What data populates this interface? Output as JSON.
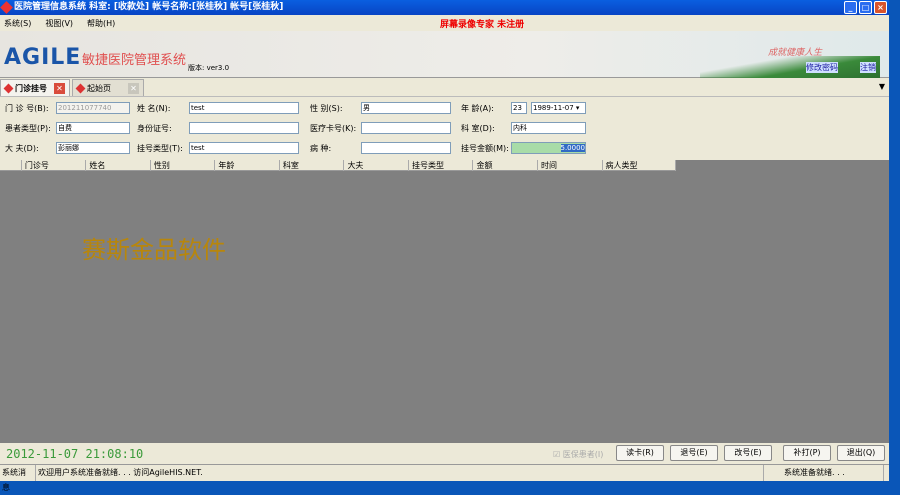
{
  "window": {
    "title": "医院管理信息系统 科室: [收款处] 帐号名称:[张桂秋] 帐号[张桂秋]",
    "controls": [
      "_",
      "□",
      "×"
    ]
  },
  "menu": {
    "items": [
      "系统(S)",
      "视图(V)",
      "帮助(H)"
    ],
    "register_notice": "屏幕录像专家 未注册"
  },
  "banner": {
    "logo": "AGILE",
    "system_name": "敏捷医院管理系统",
    "version": "版本: ver3.0",
    "slogan": "成就健康人生",
    "links": [
      "修改密码",
      "注销"
    ]
  },
  "tabs": [
    {
      "label": "门诊挂号",
      "active": true
    },
    {
      "label": "起始页",
      "active": false
    }
  ],
  "form": {
    "clinic_no": {
      "label": "门 诊 号(B):",
      "value": "201211077740"
    },
    "name": {
      "label": "姓    名(N):",
      "value": "test"
    },
    "gender": {
      "label": "性    别(S):",
      "value": "男"
    },
    "age": {
      "label": "年    龄(A):",
      "value": "23",
      "birth": "1989-11-07"
    },
    "patient_type": {
      "label": "患者类型(P):",
      "value": "自费"
    },
    "id_card": {
      "label": "身份证号:",
      "value": ""
    },
    "medical_card": {
      "label": "医疗卡号(K):",
      "value": ""
    },
    "department": {
      "label": "科    室(D):",
      "value": "内科"
    },
    "doctor": {
      "label": "大    夫(D):",
      "value": "彭丽娜"
    },
    "reg_type": {
      "label": "挂号类型(T):",
      "value": "test"
    },
    "disease": {
      "label": "病    种:",
      "value": ""
    },
    "amount": {
      "label": "挂号金额(M):",
      "value": "5.0000"
    }
  },
  "grid": {
    "columns": [
      "",
      "门诊号",
      "姓名",
      "性别",
      "年龄",
      "科室",
      "大夫",
      "挂号类型",
      "金额",
      "时间",
      "病人类型"
    ]
  },
  "watermark": "赛斯金品软件",
  "bottom": {
    "clock": "2012-11-07 21:08:10",
    "insured_checkbox": "医保患者(I)",
    "buttons": [
      "读卡(R)",
      "退号(E)",
      "改号(E)",
      "补打(P)",
      "退出(Q)"
    ]
  },
  "status": {
    "label": "系统消息",
    "message": "欢迎用户系统准备就绪. . . 访问AgileHIS.NET.",
    "right": "系统准备就绪. . ."
  }
}
